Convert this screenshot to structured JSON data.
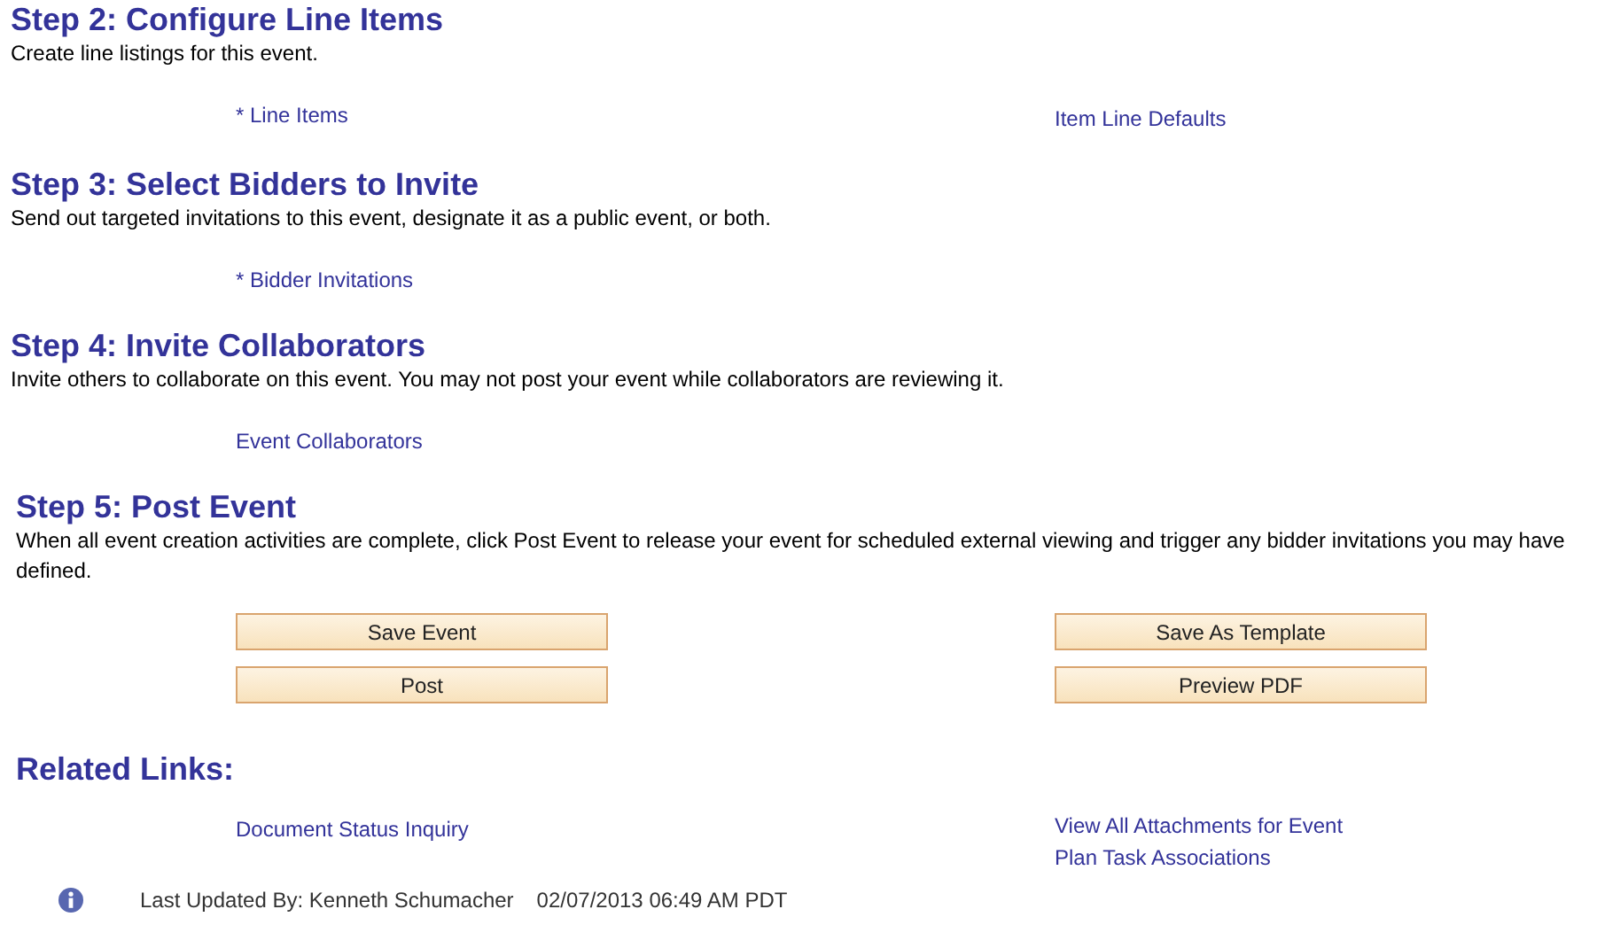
{
  "steps": [
    {
      "title": "Step 2: Configure Line Items",
      "description": "Create line listings for this event.",
      "left_links": [
        "* Line Items"
      ],
      "right_links": [
        "Item Line Defaults"
      ]
    },
    {
      "title": "Step 3: Select Bidders to Invite",
      "description": "Send out targeted invitations to this event, designate it as a public event, or both.",
      "left_links": [
        "* Bidder Invitations"
      ]
    },
    {
      "title": "Step 4: Invite Collaborators",
      "description": "Invite others to collaborate on this event. You may not post your event while collaborators are reviewing it.",
      "left_links": [
        "Event Collaborators"
      ]
    }
  ],
  "post": {
    "title": "Step 5: Post Event",
    "description": "When all event creation activities are complete, click Post Event to release your event for scheduled external viewing and trigger any bidder invitations you may have defined.",
    "left_buttons": [
      "Save Event",
      "Post"
    ],
    "right_buttons": [
      "Save As Template",
      "Preview PDF"
    ]
  },
  "related": {
    "title": "Related Links:",
    "left_links": [
      "Document Status Inquiry"
    ],
    "right_links": [
      "View All Attachments for Event",
      "Plan Task Associations"
    ]
  },
  "footer": {
    "updated_by": "Last Updated By: Kenneth Schumacher",
    "timestamp": "02/07/2013 06:49 AM PDT"
  }
}
